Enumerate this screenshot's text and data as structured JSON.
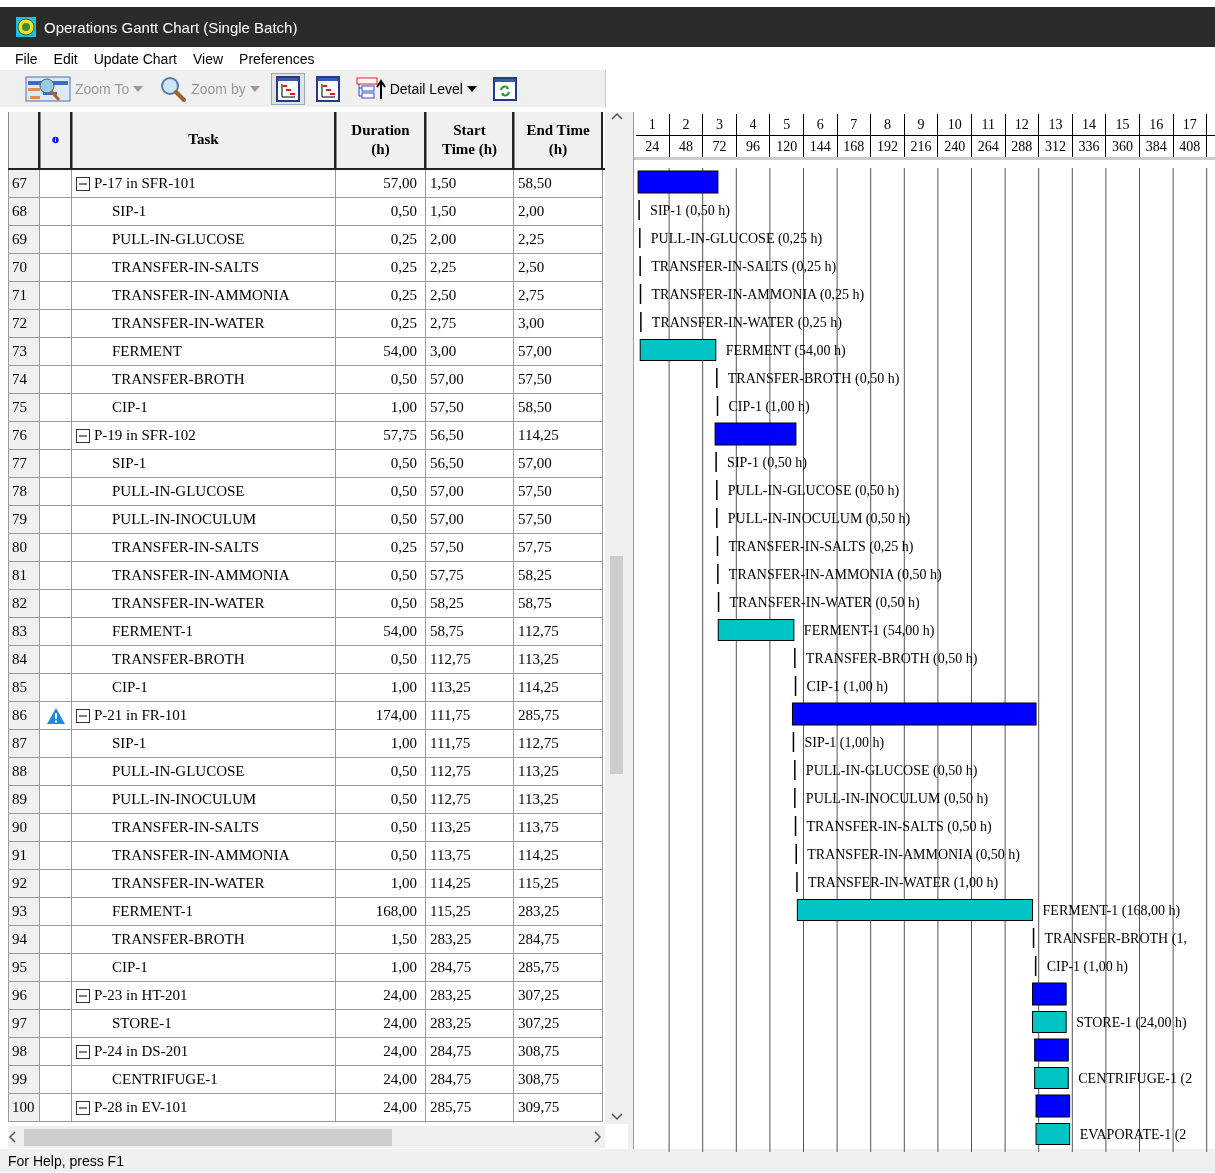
{
  "window": {
    "title": "Operations Gantt Chart (Single Batch)"
  },
  "menu": [
    "File",
    "Edit",
    "Update Chart",
    "View",
    "Preferences"
  ],
  "toolbar": [
    {
      "kind": "dropdown",
      "label": "Zoom To",
      "disabled": true
    },
    {
      "kind": "dropdown",
      "label": "Zoom by",
      "disabled": true
    },
    {
      "kind": "toggle",
      "selected": true
    },
    {
      "kind": "toggle",
      "selected": false
    },
    {
      "kind": "dropdown",
      "label": "Detail Level",
      "disabled": false
    },
    {
      "kind": "button"
    }
  ],
  "table": {
    "columns": [
      "Task",
      "Duration (h)",
      "Start Time (h)",
      "End Time (h)"
    ],
    "rows": [
      {
        "num": "67",
        "kind": "procedure",
        "expanded": true,
        "warning": false,
        "task": "P-17 in SFR-101",
        "duration": "57,00",
        "start": "1,50",
        "end": "58,50"
      },
      {
        "num": "68",
        "kind": "operation",
        "warning": false,
        "task": "SIP-1",
        "duration": "0,50",
        "start": "1,50",
        "end": "2,00"
      },
      {
        "num": "69",
        "kind": "operation",
        "warning": false,
        "task": "PULL-IN-GLUCOSE",
        "duration": "0,25",
        "start": "2,00",
        "end": "2,25"
      },
      {
        "num": "70",
        "kind": "operation",
        "warning": false,
        "task": "TRANSFER-IN-SALTS",
        "duration": "0,25",
        "start": "2,25",
        "end": "2,50"
      },
      {
        "num": "71",
        "kind": "operation",
        "warning": false,
        "task": "TRANSFER-IN-AMMONIA",
        "duration": "0,25",
        "start": "2,50",
        "end": "2,75"
      },
      {
        "num": "72",
        "kind": "operation",
        "warning": false,
        "task": "TRANSFER-IN-WATER",
        "duration": "0,25",
        "start": "2,75",
        "end": "3,00"
      },
      {
        "num": "73",
        "kind": "operation",
        "warning": false,
        "task": "FERMENT",
        "duration": "54,00",
        "start": "3,00",
        "end": "57,00"
      },
      {
        "num": "74",
        "kind": "operation",
        "warning": false,
        "task": "TRANSFER-BROTH",
        "duration": "0,50",
        "start": "57,00",
        "end": "57,50"
      },
      {
        "num": "75",
        "kind": "operation",
        "warning": false,
        "task": "CIP-1",
        "duration": "1,00",
        "start": "57,50",
        "end": "58,50"
      },
      {
        "num": "76",
        "kind": "procedure",
        "expanded": true,
        "warning": false,
        "task": "P-19 in SFR-102",
        "duration": "57,75",
        "start": "56,50",
        "end": "114,25"
      },
      {
        "num": "77",
        "kind": "operation",
        "warning": false,
        "task": "SIP-1",
        "duration": "0,50",
        "start": "56,50",
        "end": "57,00"
      },
      {
        "num": "78",
        "kind": "operation",
        "warning": false,
        "task": "PULL-IN-GLUCOSE",
        "duration": "0,50",
        "start": "57,00",
        "end": "57,50"
      },
      {
        "num": "79",
        "kind": "operation",
        "warning": false,
        "task": "PULL-IN-INOCULUM",
        "duration": "0,50",
        "start": "57,00",
        "end": "57,50"
      },
      {
        "num": "80",
        "kind": "operation",
        "warning": false,
        "task": "TRANSFER-IN-SALTS",
        "duration": "0,25",
        "start": "57,50",
        "end": "57,75"
      },
      {
        "num": "81",
        "kind": "operation",
        "warning": false,
        "task": "TRANSFER-IN-AMMONIA",
        "duration": "0,50",
        "start": "57,75",
        "end": "58,25"
      },
      {
        "num": "82",
        "kind": "operation",
        "warning": false,
        "task": "TRANSFER-IN-WATER",
        "duration": "0,50",
        "start": "58,25",
        "end": "58,75"
      },
      {
        "num": "83",
        "kind": "operation",
        "warning": false,
        "task": "FERMENT-1",
        "duration": "54,00",
        "start": "58,75",
        "end": "112,75"
      },
      {
        "num": "84",
        "kind": "operation",
        "warning": false,
        "task": "TRANSFER-BROTH",
        "duration": "0,50",
        "start": "112,75",
        "end": "113,25"
      },
      {
        "num": "85",
        "kind": "operation",
        "warning": false,
        "task": "CIP-1",
        "duration": "1,00",
        "start": "113,25",
        "end": "114,25"
      },
      {
        "num": "86",
        "kind": "procedure",
        "expanded": true,
        "warning": true,
        "task": "P-21 in FR-101",
        "duration": "174,00",
        "start": "111,75",
        "end": "285,75"
      },
      {
        "num": "87",
        "kind": "operation",
        "warning": false,
        "task": "SIP-1",
        "duration": "1,00",
        "start": "111,75",
        "end": "112,75"
      },
      {
        "num": "88",
        "kind": "operation",
        "warning": false,
        "task": "PULL-IN-GLUCOSE",
        "duration": "0,50",
        "start": "112,75",
        "end": "113,25"
      },
      {
        "num": "89",
        "kind": "operation",
        "warning": false,
        "task": "PULL-IN-INOCULUM",
        "duration": "0,50",
        "start": "112,75",
        "end": "113,25"
      },
      {
        "num": "90",
        "kind": "operation",
        "warning": false,
        "task": "TRANSFER-IN-SALTS",
        "duration": "0,50",
        "start": "113,25",
        "end": "113,75"
      },
      {
        "num": "91",
        "kind": "operation",
        "warning": false,
        "task": "TRANSFER-IN-AMMONIA",
        "duration": "0,50",
        "start": "113,75",
        "end": "114,25"
      },
      {
        "num": "92",
        "kind": "operation",
        "warning": false,
        "task": "TRANSFER-IN-WATER",
        "duration": "1,00",
        "start": "114,25",
        "end": "115,25"
      },
      {
        "num": "93",
        "kind": "operation",
        "warning": false,
        "task": "FERMENT-1",
        "duration": "168,00",
        "start": "115,25",
        "end": "283,25"
      },
      {
        "num": "94",
        "kind": "operation",
        "warning": false,
        "task": "TRANSFER-BROTH",
        "duration": "1,50",
        "start": "283,25",
        "end": "284,75"
      },
      {
        "num": "95",
        "kind": "operation",
        "warning": false,
        "task": "CIP-1",
        "duration": "1,00",
        "start": "284,75",
        "end": "285,75"
      },
      {
        "num": "96",
        "kind": "procedure",
        "expanded": true,
        "warning": false,
        "task": "P-23 in HT-201",
        "duration": "24,00",
        "start": "283,25",
        "end": "307,25"
      },
      {
        "num": "97",
        "kind": "operation",
        "warning": false,
        "task": "STORE-1",
        "duration": "24,00",
        "start": "283,25",
        "end": "307,25"
      },
      {
        "num": "98",
        "kind": "procedure",
        "expanded": true,
        "warning": false,
        "task": "P-24 in DS-201",
        "duration": "24,00",
        "start": "284,75",
        "end": "308,75"
      },
      {
        "num": "99",
        "kind": "operation",
        "warning": false,
        "task": "CENTRIFUGE-1",
        "duration": "24,00",
        "start": "284,75",
        "end": "308,75"
      },
      {
        "num": "100",
        "kind": "procedure",
        "expanded": true,
        "warning": false,
        "task": "P-28 in EV-101",
        "duration": "24,00",
        "start": "285,75",
        "end": "309,75"
      }
    ]
  },
  "gantt": {
    "days": [
      "1",
      "2",
      "3",
      "4",
      "5",
      "6",
      "7",
      "8",
      "9",
      "10",
      "11",
      "12",
      "13",
      "14",
      "15",
      "16",
      "17"
    ],
    "hours": [
      "24",
      "48",
      "72",
      "96",
      "120",
      "144",
      "168",
      "192",
      "216",
      "240",
      "264",
      "288",
      "312",
      "336",
      "360",
      "384",
      "408"
    ],
    "items": [
      {
        "kind": "procedure"
      },
      {
        "kind": "tick",
        "label": "SIP-1 (0,50 h)"
      },
      {
        "kind": "tick",
        "label": "PULL-IN-GLUCOSE (0,25 h)"
      },
      {
        "kind": "tick",
        "label": "TRANSFER-IN-SALTS (0,25 h)"
      },
      {
        "kind": "tick",
        "label": "TRANSFER-IN-AMMONIA (0,25 h)"
      },
      {
        "kind": "tick",
        "label": "TRANSFER-IN-WATER (0,25 h)"
      },
      {
        "kind": "bar",
        "label": "FERMENT (54,00 h)"
      },
      {
        "kind": "tick",
        "label": "TRANSFER-BROTH (0,50 h)"
      },
      {
        "kind": "tick",
        "label": "CIP-1 (1,00 h)"
      },
      {
        "kind": "procedure"
      },
      {
        "kind": "tick",
        "label": "SIP-1 (0,50 h)"
      },
      {
        "kind": "tick",
        "label": "PULL-IN-GLUCOSE (0,50 h)"
      },
      {
        "kind": "tick",
        "label": "PULL-IN-INOCULUM (0,50 h)"
      },
      {
        "kind": "tick",
        "label": "TRANSFER-IN-SALTS (0,25 h)"
      },
      {
        "kind": "tick",
        "label": "TRANSFER-IN-AMMONIA (0,50 h)"
      },
      {
        "kind": "tick",
        "label": "TRANSFER-IN-WATER (0,50 h)"
      },
      {
        "kind": "bar",
        "label": "FERMENT-1 (54,00 h)"
      },
      {
        "kind": "tick",
        "label": "TRANSFER-BROTH (0,50 h)"
      },
      {
        "kind": "tick",
        "label": "CIP-1 (1,00 h)"
      },
      {
        "kind": "procedure"
      },
      {
        "kind": "tick",
        "label": "SIP-1 (1,00 h)"
      },
      {
        "kind": "tick",
        "label": "PULL-IN-GLUCOSE (0,50 h)"
      },
      {
        "kind": "tick",
        "label": "PULL-IN-INOCULUM (0,50 h)"
      },
      {
        "kind": "tick",
        "label": "TRANSFER-IN-SALTS (0,50 h)"
      },
      {
        "kind": "tick",
        "label": "TRANSFER-IN-AMMONIA (0,50 h)"
      },
      {
        "kind": "tick",
        "label": "TRANSFER-IN-WATER (1,00 h)"
      },
      {
        "kind": "bar",
        "label": "FERMENT-1 (168,00 h)"
      },
      {
        "kind": "tick",
        "label": "TRANSFER-BROTH (1,"
      },
      {
        "kind": "tick",
        "label": "CIP-1 (1,00 h)"
      },
      {
        "kind": "procedure"
      },
      {
        "kind": "bar",
        "label": "STORE-1 (24,00 h)"
      },
      {
        "kind": "procedure"
      },
      {
        "kind": "bar",
        "label": "CENTRIFUGE-1 (2"
      },
      {
        "kind": "procedure"
      },
      {
        "kind": "bar",
        "label": "EVAPORATE-1 (2"
      }
    ]
  },
  "status_bar": "For Help, press F1"
}
